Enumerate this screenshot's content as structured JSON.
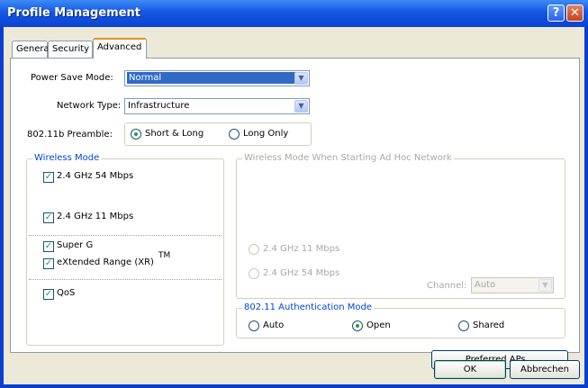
{
  "window": {
    "title": "Profile Management",
    "help_label": "?",
    "close_label": "✕"
  },
  "tabs": [
    {
      "label": "General",
      "active": false
    },
    {
      "label": "Security",
      "active": false
    },
    {
      "label": "Advanced",
      "active": true
    }
  ],
  "form": {
    "power_save_label": "Power Save Mode:",
    "power_save_value": "Normal",
    "network_type_label": "Network Type:",
    "network_type_value": "Infrastructure",
    "preamble_label": "802.11b Preamble:",
    "preamble_options": [
      {
        "label": "Short & Long",
        "selected": true
      },
      {
        "label": "Long Only",
        "selected": false
      }
    ]
  },
  "wireless_mode": {
    "title": "Wireless Mode",
    "options": [
      {
        "label": "2.4 GHz 54 Mbps",
        "checked": true
      },
      {
        "label": "2.4 GHz 11 Mbps",
        "checked": true
      }
    ],
    "super_g": {
      "label": "Super G",
      "checked": true
    },
    "xr": {
      "label": "eXtended Range (XR)",
      "superscript": "TM",
      "checked": true
    },
    "qos": {
      "label": "QoS",
      "checked": true
    }
  },
  "adhoc": {
    "title": "Wireless Mode When Starting Ad Hoc Network",
    "options": [
      {
        "label": "2.4 GHz 11 Mbps",
        "selected": false
      },
      {
        "label": "2.4 GHz 54 Mbps",
        "selected": false
      }
    ],
    "channel_label": "Channel:",
    "channel_value": "Auto"
  },
  "auth": {
    "title": "802.11 Authentication Mode",
    "options": [
      {
        "label": "Auto",
        "selected": false
      },
      {
        "label": "Open",
        "selected": true
      },
      {
        "label": "Shared",
        "selected": false
      }
    ]
  },
  "buttons": {
    "preferred_aps": "Preferred APs...",
    "ok": "OK",
    "cancel": "Abbrechen"
  },
  "colors": {
    "title_bar": "#0a43d2",
    "dialog_bg": "#ece9d8",
    "selection": "#316ac5",
    "group_title": "#0046d5",
    "check_mark": "#21a121"
  }
}
